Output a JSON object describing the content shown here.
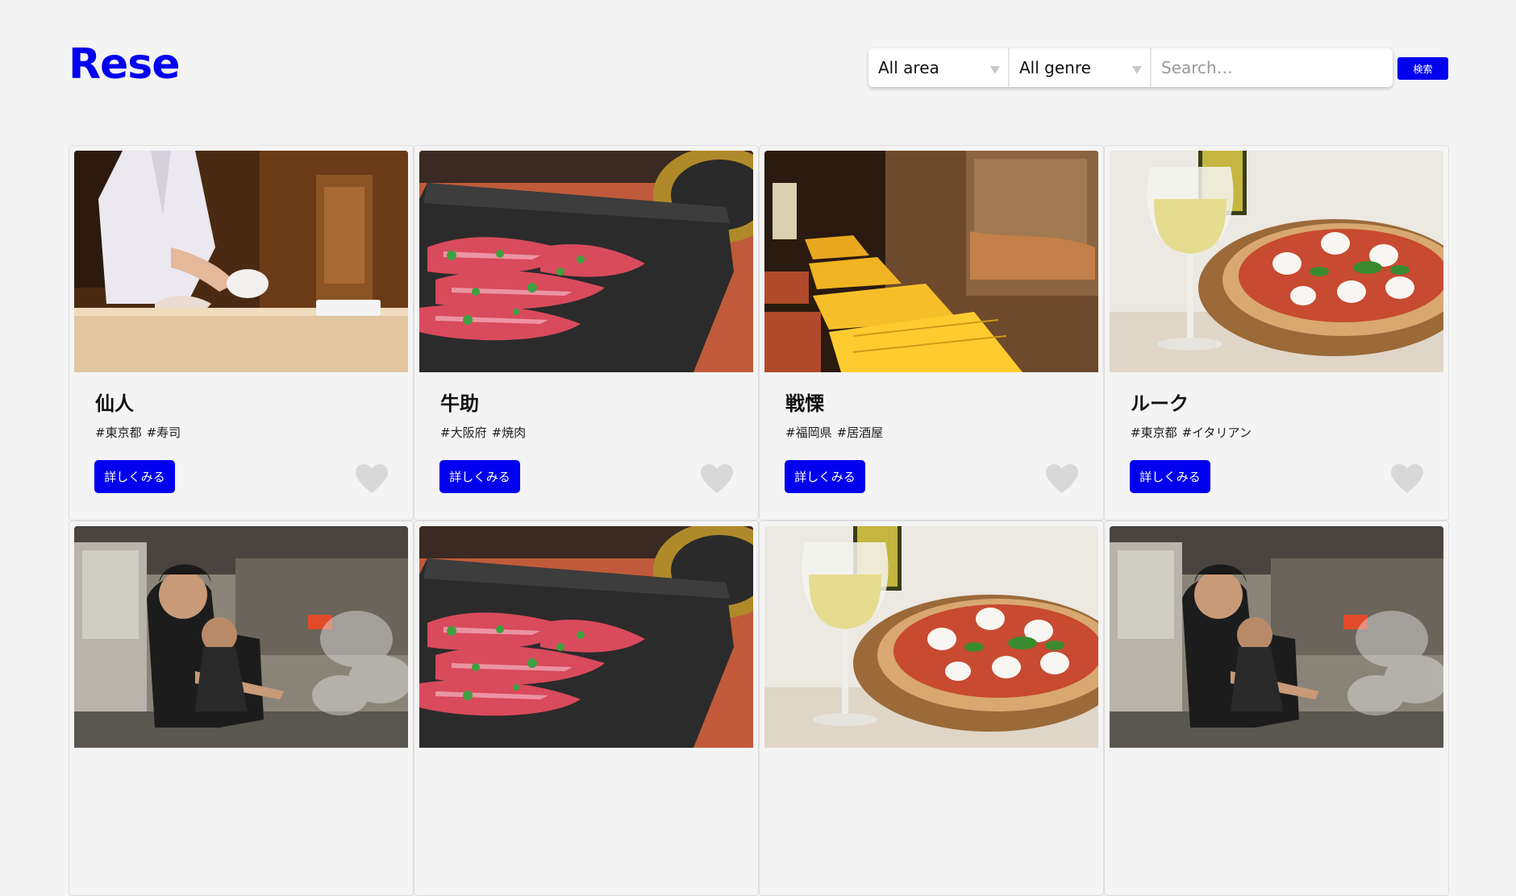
{
  "header": {
    "logo": "Rese"
  },
  "search": {
    "area_selected": "All area",
    "genre_selected": "All genre",
    "placeholder": "Search…",
    "button_label": "検索"
  },
  "colors": {
    "accent": "#0000ee",
    "heart_inactive": "#d8d8d8",
    "background": "#f4f4f4"
  },
  "cards": [
    {
      "name": "仙人",
      "tags": [
        "#東京都",
        "#寿司"
      ],
      "button": "詳しくみる",
      "icon": "heart-icon",
      "photo": "sushi-chef"
    },
    {
      "name": "牛助",
      "tags": [
        "#大阪府",
        "#焼肉"
      ],
      "button": "詳しくみる",
      "icon": "heart-icon",
      "photo": "yakiniku-meat"
    },
    {
      "name": "戦慄",
      "tags": [
        "#福岡県",
        "#居酒屋"
      ],
      "button": "詳しくみる",
      "icon": "heart-icon",
      "photo": "izakaya-interior"
    },
    {
      "name": "ルーク",
      "tags": [
        "#東京都",
        "#イタリアン"
      ],
      "button": "詳しくみる",
      "icon": "heart-icon",
      "photo": "pizza-wine"
    },
    {
      "name": "",
      "tags": [],
      "button": "",
      "icon": "",
      "photo": "ramen-kitchen"
    },
    {
      "name": "",
      "tags": [],
      "button": "",
      "icon": "",
      "photo": "yakiniku-meat"
    },
    {
      "name": "",
      "tags": [],
      "button": "",
      "icon": "",
      "photo": "pizza-wine"
    },
    {
      "name": "",
      "tags": [],
      "button": "",
      "icon": "",
      "photo": "ramen-kitchen"
    }
  ]
}
